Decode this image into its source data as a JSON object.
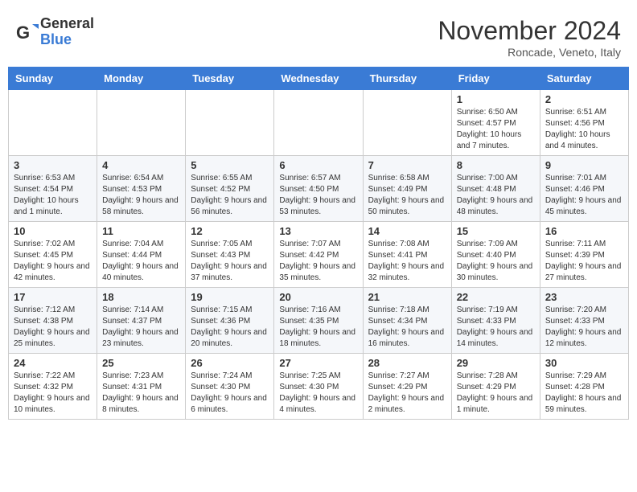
{
  "logo": {
    "general": "General",
    "blue": "Blue"
  },
  "title": "November 2024",
  "location": "Roncade, Veneto, Italy",
  "days_header": [
    "Sunday",
    "Monday",
    "Tuesday",
    "Wednesday",
    "Thursday",
    "Friday",
    "Saturday"
  ],
  "weeks": [
    [
      {
        "day": "",
        "info": ""
      },
      {
        "day": "",
        "info": ""
      },
      {
        "day": "",
        "info": ""
      },
      {
        "day": "",
        "info": ""
      },
      {
        "day": "",
        "info": ""
      },
      {
        "day": "1",
        "info": "Sunrise: 6:50 AM\nSunset: 4:57 PM\nDaylight: 10 hours and 7 minutes."
      },
      {
        "day": "2",
        "info": "Sunrise: 6:51 AM\nSunset: 4:56 PM\nDaylight: 10 hours and 4 minutes."
      }
    ],
    [
      {
        "day": "3",
        "info": "Sunrise: 6:53 AM\nSunset: 4:54 PM\nDaylight: 10 hours and 1 minute."
      },
      {
        "day": "4",
        "info": "Sunrise: 6:54 AM\nSunset: 4:53 PM\nDaylight: 9 hours and 58 minutes."
      },
      {
        "day": "5",
        "info": "Sunrise: 6:55 AM\nSunset: 4:52 PM\nDaylight: 9 hours and 56 minutes."
      },
      {
        "day": "6",
        "info": "Sunrise: 6:57 AM\nSunset: 4:50 PM\nDaylight: 9 hours and 53 minutes."
      },
      {
        "day": "7",
        "info": "Sunrise: 6:58 AM\nSunset: 4:49 PM\nDaylight: 9 hours and 50 minutes."
      },
      {
        "day": "8",
        "info": "Sunrise: 7:00 AM\nSunset: 4:48 PM\nDaylight: 9 hours and 48 minutes."
      },
      {
        "day": "9",
        "info": "Sunrise: 7:01 AM\nSunset: 4:46 PM\nDaylight: 9 hours and 45 minutes."
      }
    ],
    [
      {
        "day": "10",
        "info": "Sunrise: 7:02 AM\nSunset: 4:45 PM\nDaylight: 9 hours and 42 minutes."
      },
      {
        "day": "11",
        "info": "Sunrise: 7:04 AM\nSunset: 4:44 PM\nDaylight: 9 hours and 40 minutes."
      },
      {
        "day": "12",
        "info": "Sunrise: 7:05 AM\nSunset: 4:43 PM\nDaylight: 9 hours and 37 minutes."
      },
      {
        "day": "13",
        "info": "Sunrise: 7:07 AM\nSunset: 4:42 PM\nDaylight: 9 hours and 35 minutes."
      },
      {
        "day": "14",
        "info": "Sunrise: 7:08 AM\nSunset: 4:41 PM\nDaylight: 9 hours and 32 minutes."
      },
      {
        "day": "15",
        "info": "Sunrise: 7:09 AM\nSunset: 4:40 PM\nDaylight: 9 hours and 30 minutes."
      },
      {
        "day": "16",
        "info": "Sunrise: 7:11 AM\nSunset: 4:39 PM\nDaylight: 9 hours and 27 minutes."
      }
    ],
    [
      {
        "day": "17",
        "info": "Sunrise: 7:12 AM\nSunset: 4:38 PM\nDaylight: 9 hours and 25 minutes."
      },
      {
        "day": "18",
        "info": "Sunrise: 7:14 AM\nSunset: 4:37 PM\nDaylight: 9 hours and 23 minutes."
      },
      {
        "day": "19",
        "info": "Sunrise: 7:15 AM\nSunset: 4:36 PM\nDaylight: 9 hours and 20 minutes."
      },
      {
        "day": "20",
        "info": "Sunrise: 7:16 AM\nSunset: 4:35 PM\nDaylight: 9 hours and 18 minutes."
      },
      {
        "day": "21",
        "info": "Sunrise: 7:18 AM\nSunset: 4:34 PM\nDaylight: 9 hours and 16 minutes."
      },
      {
        "day": "22",
        "info": "Sunrise: 7:19 AM\nSunset: 4:33 PM\nDaylight: 9 hours and 14 minutes."
      },
      {
        "day": "23",
        "info": "Sunrise: 7:20 AM\nSunset: 4:33 PM\nDaylight: 9 hours and 12 minutes."
      }
    ],
    [
      {
        "day": "24",
        "info": "Sunrise: 7:22 AM\nSunset: 4:32 PM\nDaylight: 9 hours and 10 minutes."
      },
      {
        "day": "25",
        "info": "Sunrise: 7:23 AM\nSunset: 4:31 PM\nDaylight: 9 hours and 8 minutes."
      },
      {
        "day": "26",
        "info": "Sunrise: 7:24 AM\nSunset: 4:30 PM\nDaylight: 9 hours and 6 minutes."
      },
      {
        "day": "27",
        "info": "Sunrise: 7:25 AM\nSunset: 4:30 PM\nDaylight: 9 hours and 4 minutes."
      },
      {
        "day": "28",
        "info": "Sunrise: 7:27 AM\nSunset: 4:29 PM\nDaylight: 9 hours and 2 minutes."
      },
      {
        "day": "29",
        "info": "Sunrise: 7:28 AM\nSunset: 4:29 PM\nDaylight: 9 hours and 1 minute."
      },
      {
        "day": "30",
        "info": "Sunrise: 7:29 AM\nSunset: 4:28 PM\nDaylight: 8 hours and 59 minutes."
      }
    ]
  ]
}
